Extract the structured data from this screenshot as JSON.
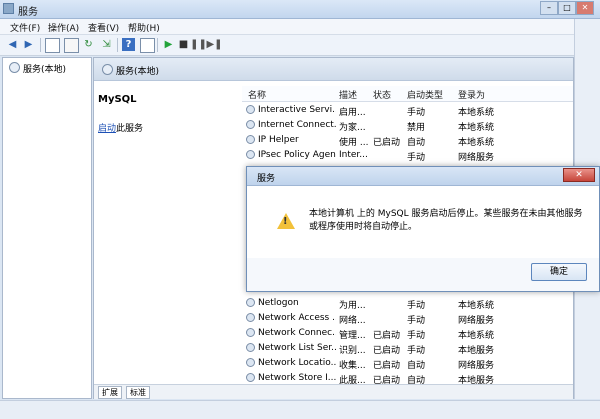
{
  "window": {
    "title": "服务"
  },
  "menu": [
    "文件(F)",
    "操作(A)",
    "查看(V)",
    "帮助(H)"
  ],
  "tree": {
    "root": "服务(本地)"
  },
  "pane": {
    "header": "服务(本地)",
    "selected_service": "MySQL",
    "action_link": "启动",
    "action_suffix": "此服务"
  },
  "list": {
    "columns": [
      "名称",
      "描述",
      "状态",
      "启动类型",
      "登录为"
    ],
    "rows": [
      [
        "Interactive Servi...",
        "启用...",
        "",
        "手动",
        "本地系统"
      ],
      [
        "Internet Connect...",
        "为家...",
        "",
        "禁用",
        "本地系统"
      ],
      [
        "IP Helper",
        "使用 ...",
        "已启动",
        "自动",
        "本地系统"
      ],
      [
        "IPsec Policy Agent",
        "Inter...",
        "",
        "手动",
        "网络服务"
      ],
      [
        "Netlogon",
        "为用...",
        "",
        "手动",
        "本地系统"
      ],
      [
        "Network Access ...",
        "网络...",
        "",
        "手动",
        "网络服务"
      ],
      [
        "Network Connec...",
        "管理...",
        "已启动",
        "手动",
        "本地系统"
      ],
      [
        "Network List Ser...",
        "识别...",
        "已启动",
        "手动",
        "本地服务"
      ],
      [
        "Network Locatio...",
        "收集...",
        "已启动",
        "自动",
        "网络服务"
      ],
      [
        "Network Store I...",
        "此服...",
        "已启动",
        "自动",
        "本地服务"
      ]
    ]
  },
  "tabs": [
    "扩展",
    "标准"
  ],
  "dialog": {
    "title": "服务",
    "message": "本地计算机 上的 MySQL 服务启动后停止。某些服务在未由其他服务或程序使用时将自动停止。",
    "ok_label": "确定",
    "close_label": "✕"
  }
}
